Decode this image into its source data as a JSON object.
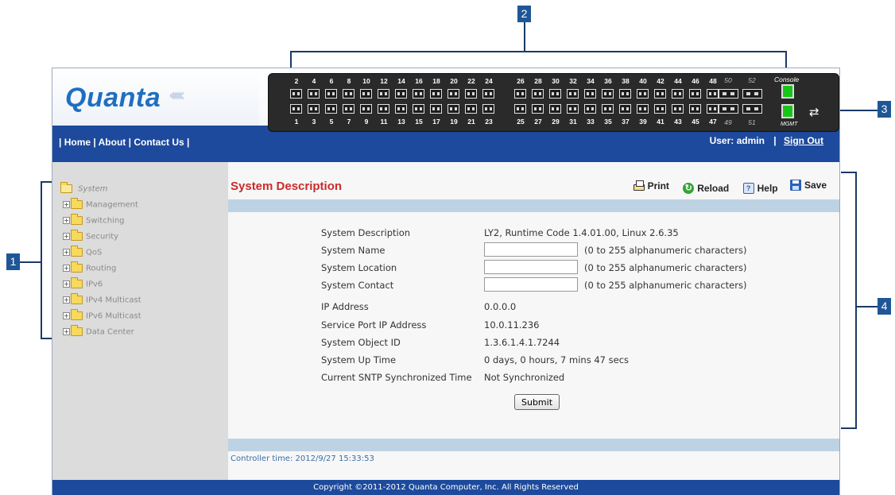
{
  "callouts": [
    "1",
    "2",
    "3",
    "4"
  ],
  "header": {
    "logo_text": "Quanta",
    "nav": {
      "sep": "|",
      "home": "Home",
      "about": "About",
      "contact": "Contact Us"
    },
    "user_label": "User: admin",
    "user_sep": "|",
    "signout": "Sign Out"
  },
  "switch_panel": {
    "top_ports": [
      "2",
      "4",
      "6",
      "8",
      "10",
      "12",
      "14",
      "16",
      "18",
      "20",
      "22",
      "24",
      "26",
      "28",
      "30",
      "32",
      "34",
      "36",
      "38",
      "40",
      "42",
      "44",
      "46",
      "48"
    ],
    "bottom_ports": [
      "1",
      "3",
      "5",
      "7",
      "9",
      "11",
      "13",
      "15",
      "17",
      "19",
      "21",
      "23",
      "25",
      "27",
      "29",
      "31",
      "33",
      "35",
      "37",
      "39",
      "41",
      "43",
      "45",
      "47"
    ],
    "sfp_top": [
      "50",
      "52"
    ],
    "sfp_bottom": [
      "49",
      "51"
    ],
    "console_label": "Console",
    "mgmt_label": "MGMT",
    "swap_icon": "⇄"
  },
  "sidebar": {
    "root": "System",
    "items": [
      {
        "label": "Management"
      },
      {
        "label": "Switching"
      },
      {
        "label": "Security"
      },
      {
        "label": "QoS"
      },
      {
        "label": "Routing"
      },
      {
        "label": "IPv6"
      },
      {
        "label": "IPv4 Multicast"
      },
      {
        "label": "IPv6 Multicast"
      },
      {
        "label": "Data Center"
      }
    ]
  },
  "main": {
    "title": "System Description",
    "toolbar": {
      "print": "Print",
      "reload": "Reload",
      "help": "Help",
      "save": "Save"
    },
    "fields": {
      "description": {
        "label": "System Description",
        "value": "LY2, Runtime Code 1.4.01.00, Linux 2.6.35"
      },
      "name": {
        "label": "System Name",
        "value": "",
        "hint": "(0 to 255 alphanumeric characters)"
      },
      "location": {
        "label": "System Location",
        "value": "",
        "hint": "(0 to 255 alphanumeric characters)"
      },
      "contact": {
        "label": "System Contact",
        "value": "",
        "hint": "(0 to 255 alphanumeric characters)"
      },
      "ip": {
        "label": "IP Address",
        "value": "0.0.0.0"
      },
      "service_ip": {
        "label": "Service Port IP Address",
        "value": "10.0.11.236"
      },
      "object_id": {
        "label": "System Object ID",
        "value": "1.3.6.1.4.1.7244"
      },
      "uptime": {
        "label": "System Up Time",
        "value": "0 days, 0 hours, 7 mins 47 secs"
      },
      "sntp": {
        "label": "Current SNTP Synchronized Time",
        "value": "Not Synchronized"
      }
    },
    "submit": "Submit",
    "controller_time": "Controller time: 2012/9/27 15:33:53"
  },
  "footer": "Copyright ©2011-2012 Quanta Computer, Inc.   All Rights Reserved"
}
